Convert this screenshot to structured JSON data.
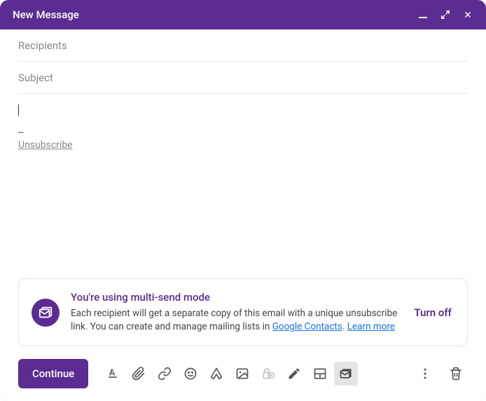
{
  "header": {
    "title": "New Message"
  },
  "fields": {
    "recipients_placeholder": "Recipients",
    "recipients_value": "",
    "subject_placeholder": "Subject",
    "subject_value": ""
  },
  "body": {
    "signature_separator": "--",
    "unsubscribe_label": "Unsubscribe"
  },
  "notice": {
    "title": "You're using multi-send mode",
    "desc_part1": "Each recipient will get a separate copy of this email with a unique unsubscribe link. You can create and manage mailing lists in ",
    "link_contacts": "Google Contacts",
    "desc_part2": ". ",
    "link_learn": "Learn more",
    "action": "Turn off"
  },
  "toolbar": {
    "continue_label": "Continue"
  }
}
